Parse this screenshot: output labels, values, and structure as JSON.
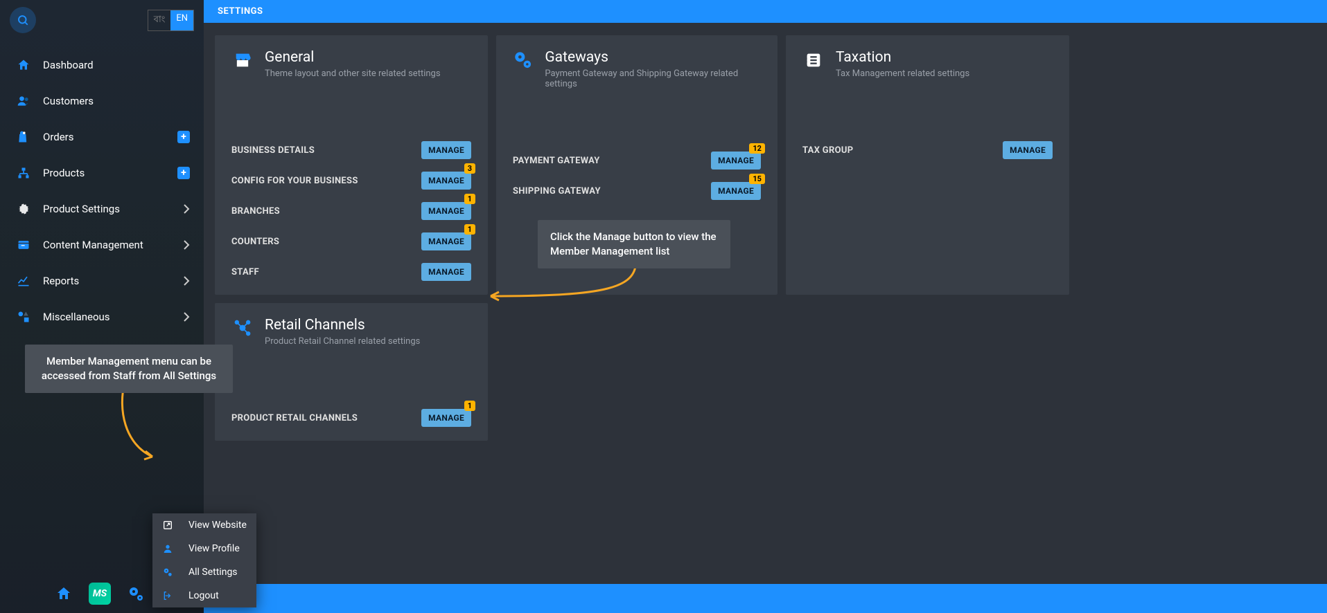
{
  "header": {
    "title": "SETTINGS"
  },
  "lang": {
    "bn": "বাং",
    "en": "EN"
  },
  "sidebar": {
    "items": [
      {
        "label": "Dashboard"
      },
      {
        "label": "Customers"
      },
      {
        "label": "Orders"
      },
      {
        "label": "Products"
      },
      {
        "label": "Product Settings"
      },
      {
        "label": "Content Management"
      },
      {
        "label": "Reports"
      },
      {
        "label": "Miscellaneous"
      }
    ]
  },
  "popup": {
    "view_website": "View Website",
    "view_profile": "View Profile",
    "all_settings": "All Settings",
    "logout": "Logout"
  },
  "footer": {
    "ms": "MS"
  },
  "cards": {
    "general": {
      "title": "General",
      "subtitle": "Theme layout and other site related settings",
      "rows": [
        {
          "label": "BUSINESS DETAILS",
          "manage": "MANAGE"
        },
        {
          "label": "CONFIG FOR YOUR BUSINESS",
          "manage": "MANAGE",
          "badge": "3"
        },
        {
          "label": "BRANCHES",
          "manage": "MANAGE",
          "badge": "1"
        },
        {
          "label": "COUNTERS",
          "manage": "MANAGE",
          "badge": "1"
        },
        {
          "label": "STAFF",
          "manage": "MANAGE"
        }
      ]
    },
    "gateways": {
      "title": "Gateways",
      "subtitle": "Payment Gateway and Shipping Gateway related settings",
      "rows": [
        {
          "label": "PAYMENT GATEWAY",
          "manage": "MANAGE",
          "badge": "12"
        },
        {
          "label": "SHIPPING GATEWAY",
          "manage": "MANAGE",
          "badge": "15"
        }
      ]
    },
    "taxation": {
      "title": "Taxation",
      "subtitle": "Tax Management related settings",
      "rows": [
        {
          "label": "TAX GROUP",
          "manage": "MANAGE"
        }
      ]
    },
    "retail": {
      "title": "Retail Channels",
      "subtitle": "Product Retail Channel related settings",
      "rows": [
        {
          "label": "PRODUCT RETAIL CHANNELS",
          "manage": "MANAGE",
          "badge": "1"
        }
      ]
    }
  },
  "tooltips": {
    "t1": "Member Management menu can be accessed from Staff from All Settings",
    "t2": "Click the Manage button to view the Member Management list"
  }
}
